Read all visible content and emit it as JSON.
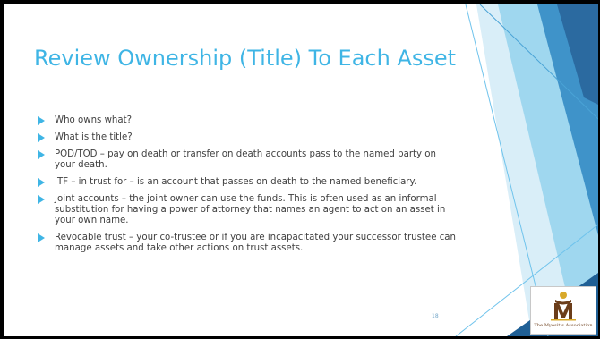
{
  "slide": {
    "title": "Review Ownership (Title) To Each Asset",
    "bullets": [
      "Who owns what?",
      "What is the title?",
      "POD/TOD – pay on death or transfer on death accounts pass to the named party on your death.",
      "ITF – in trust for – is an account that passes on death to the named beneficiary.",
      "Joint accounts – the joint owner can use the funds. This is often used as an informal substitution for having a power of attorney that names an agent to act on an asset in your own name.",
      "Revocable trust – your co-trustee or if you are incapacitated your successor trustee can manage assets and take other actions on trust assets."
    ],
    "page_number": "18"
  },
  "logo": {
    "text": "The Myositis Association",
    "icon": "myositis-logo-icon"
  },
  "colors": {
    "accent": "#3fb5e5",
    "body_text": "#404040",
    "deco_dark": "#2b6aa0",
    "deco_mid": "#3f93c9",
    "deco_light": "#9fd7ef",
    "logo_brown": "#6b3d1a",
    "logo_gold": "#d8a92a"
  }
}
